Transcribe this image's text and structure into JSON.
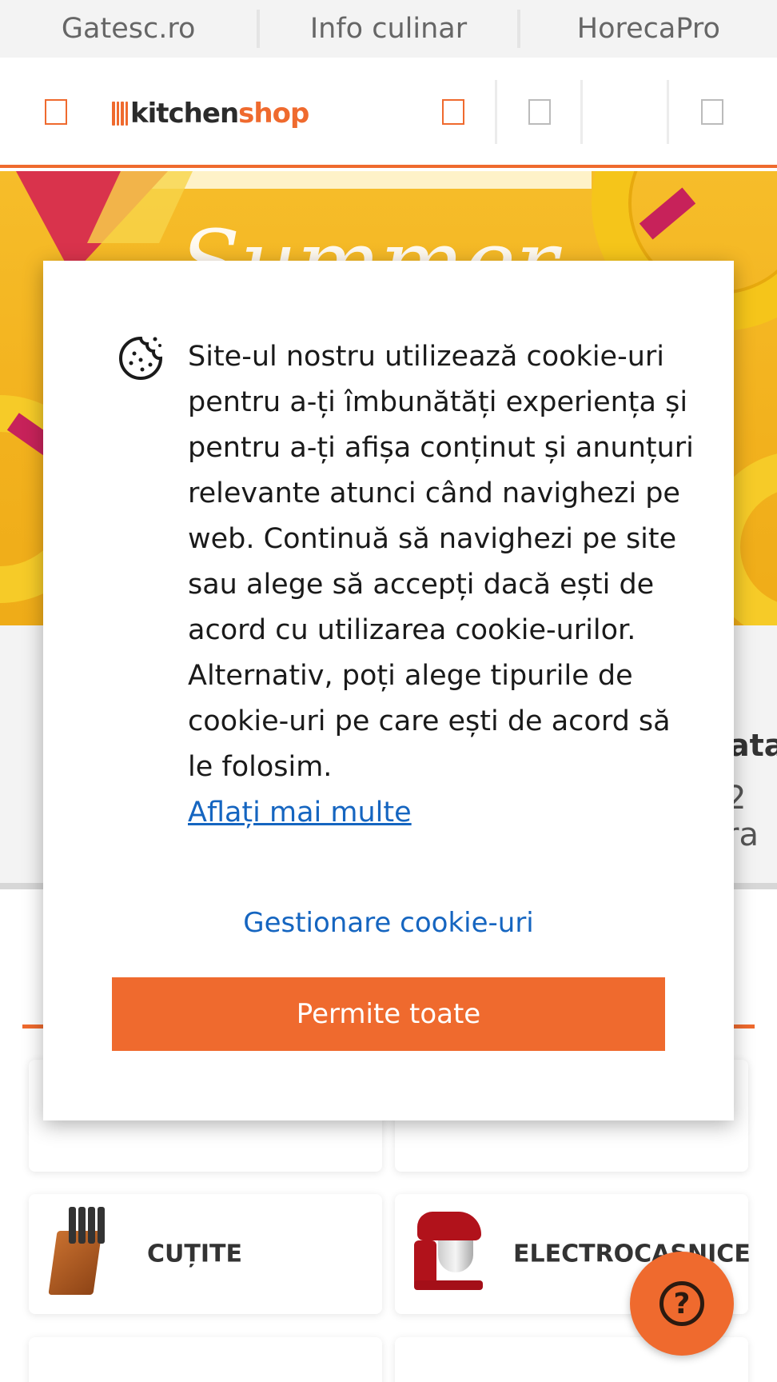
{
  "network_bar": {
    "links": [
      "Gatesc.ro",
      "Info culinar",
      "HorecaPro"
    ]
  },
  "header": {
    "logo_left": "kitchen",
    "logo_right": "shop",
    "accent_color": "#ef6a2e",
    "icons": [
      "menu-icon",
      "search-icon",
      "account-icon",
      "wishlist-icon",
      "cart-icon"
    ]
  },
  "banner": {
    "title": "Summer"
  },
  "background": {
    "partial_title": "ata",
    "partial_sub": "2 ra"
  },
  "categories": [
    {
      "label": "CUȚITE"
    },
    {
      "label": "ELECTROCASNICE"
    }
  ],
  "cookie_modal": {
    "message": "Site-ul nostru utilizează cookie-uri pentru a-ți îmbunătăți experiența și pentru a-ți afișa conținut și anunțuri relevante atunci când navighezi pe web. Continuă să navighezi pe site sau alege să accepți dacă ești de acord cu utilizarea cookie-urilor. Alternativ, poți alege tipurile de cookie-uri pe care ești de acord să le folosim.",
    "learn_more": "Aflați mai multe",
    "manage": "Gestionare cookie-uri",
    "accept_all": "Permite toate",
    "link_color": "#1565c0"
  },
  "help_button": {
    "glyph": "?"
  }
}
